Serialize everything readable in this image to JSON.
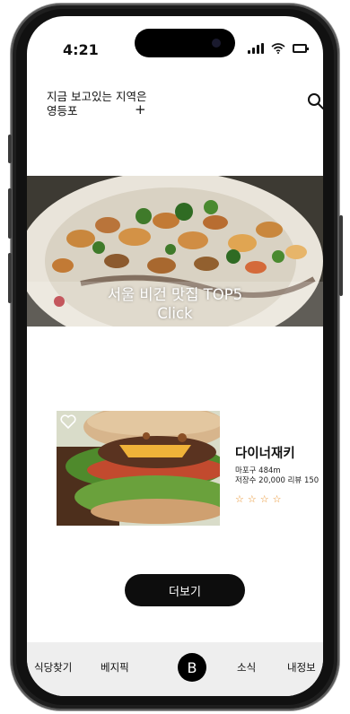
{
  "status_bar": {
    "time": "4:21"
  },
  "header": {
    "region_label_line1": "지금 보고있는 지역은",
    "region_label_line2": "영등포",
    "region_add": "+",
    "search_icon": "search-icon"
  },
  "banner": {
    "title": "서울 비건 맛집 TOP5",
    "subtitle": "Click"
  },
  "card": {
    "name": "다이너재키",
    "location": "마포구 484m",
    "price_reviews": "저장수 20,000  리뷰 150",
    "rating": 4,
    "star_color": "#e8902b",
    "favorite_icon": "heart-icon"
  },
  "more_button": {
    "label": "더보기"
  },
  "tabs": [
    {
      "label": "식당찾기"
    },
    {
      "label": "베지픽"
    },
    {
      "label": "B"
    },
    {
      "label": "소식"
    },
    {
      "label": "내정보"
    }
  ],
  "colors": {
    "accent": "#000000",
    "tabbar_bg": "#eeeeee"
  }
}
